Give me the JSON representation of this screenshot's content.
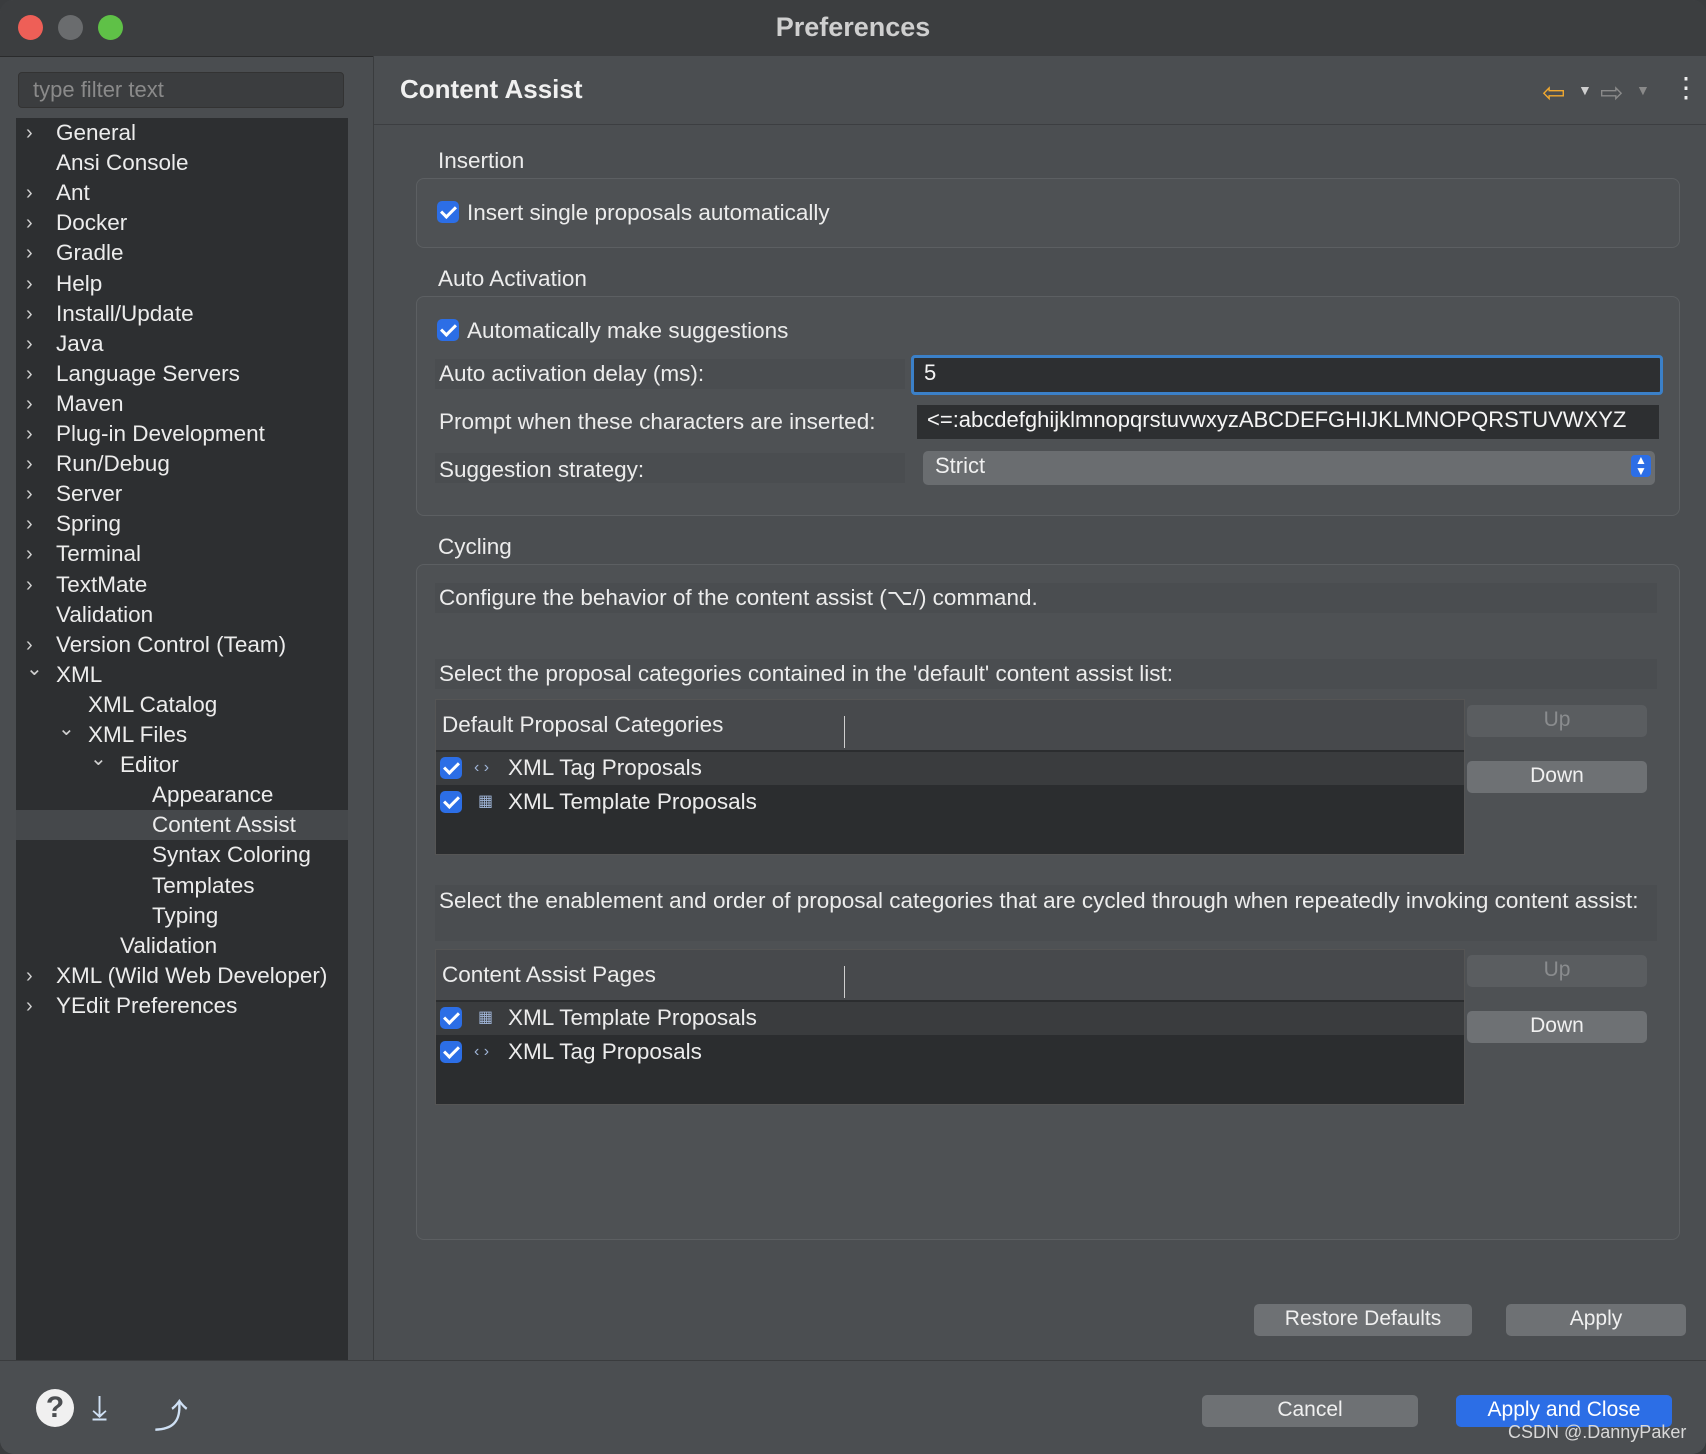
{
  "window": {
    "title": "Preferences"
  },
  "sidebar": {
    "filter_placeholder": "type filter text",
    "items": [
      {
        "label": "General",
        "expander": "collapsed",
        "depth": 0
      },
      {
        "label": "Ansi Console",
        "expander": "none",
        "depth": 0
      },
      {
        "label": "Ant",
        "expander": "collapsed",
        "depth": 0
      },
      {
        "label": "Docker",
        "expander": "collapsed",
        "depth": 0
      },
      {
        "label": "Gradle",
        "expander": "collapsed",
        "depth": 0
      },
      {
        "label": "Help",
        "expander": "collapsed",
        "depth": 0
      },
      {
        "label": "Install/Update",
        "expander": "collapsed",
        "depth": 0
      },
      {
        "label": "Java",
        "expander": "collapsed",
        "depth": 0
      },
      {
        "label": "Language Servers",
        "expander": "collapsed",
        "depth": 0
      },
      {
        "label": "Maven",
        "expander": "collapsed",
        "depth": 0
      },
      {
        "label": "Plug-in Development",
        "expander": "collapsed",
        "depth": 0
      },
      {
        "label": "Run/Debug",
        "expander": "collapsed",
        "depth": 0
      },
      {
        "label": "Server",
        "expander": "collapsed",
        "depth": 0
      },
      {
        "label": "Spring",
        "expander": "collapsed",
        "depth": 0
      },
      {
        "label": "Terminal",
        "expander": "collapsed",
        "depth": 0
      },
      {
        "label": "TextMate",
        "expander": "collapsed",
        "depth": 0
      },
      {
        "label": "Validation",
        "expander": "none",
        "depth": 0
      },
      {
        "label": "Version Control (Team)",
        "expander": "collapsed",
        "depth": 0
      },
      {
        "label": "XML",
        "expander": "expanded",
        "depth": 0
      },
      {
        "label": "XML Catalog",
        "expander": "none",
        "depth": 1
      },
      {
        "label": "XML Files",
        "expander": "expanded",
        "depth": 1
      },
      {
        "label": "Editor",
        "expander": "expanded",
        "depth": 2
      },
      {
        "label": "Appearance",
        "expander": "none",
        "depth": 3
      },
      {
        "label": "Content Assist",
        "expander": "none",
        "depth": 3,
        "selected": true
      },
      {
        "label": "Syntax Coloring",
        "expander": "none",
        "depth": 3
      },
      {
        "label": "Templates",
        "expander": "none",
        "depth": 3
      },
      {
        "label": "Typing",
        "expander": "none",
        "depth": 3
      },
      {
        "label": "Validation",
        "expander": "none",
        "depth": 2
      },
      {
        "label": "XML (Wild Web Developer)",
        "expander": "collapsed",
        "depth": 0
      },
      {
        "label": "YEdit Preferences",
        "expander": "collapsed",
        "depth": 0
      }
    ]
  },
  "page": {
    "title": "Content Assist",
    "insertion": {
      "label": "Insertion",
      "insert_single": "Insert single proposals automatically",
      "insert_single_checked": true
    },
    "auto_activation": {
      "label": "Auto Activation",
      "auto_suggest": "Automatically make suggestions",
      "auto_suggest_checked": true,
      "delay_label": "Auto activation delay (ms):",
      "delay_value": "5",
      "prompt_label": "Prompt when these characters are inserted:",
      "prompt_value": "<=:abcdefghijklmnopqrstuvwxyzABCDEFGHIJKLMNOPQRSTUVWXYZ",
      "strategy_label": "Suggestion strategy:",
      "strategy_value": "Strict"
    },
    "cycling": {
      "label": "Cycling",
      "description": "Configure the behavior of the content assist (⌥/) command.",
      "default_list_label": "Select the proposal categories contained in the 'default' content assist list:",
      "default_table": {
        "header": "Default Proposal Categories",
        "rows": [
          {
            "label": "XML Tag Proposals",
            "icon": "xml-tag-icon",
            "checked": true
          },
          {
            "label": "XML Template Proposals",
            "icon": "xml-template-icon",
            "checked": true
          }
        ]
      },
      "cycled_label": "Select the enablement and order of proposal categories that are cycled through when repeatedly invoking content assist:",
      "pages_table": {
        "header": "Content Assist Pages",
        "rows": [
          {
            "label": "XML Template Proposals",
            "icon": "xml-template-icon",
            "checked": true
          },
          {
            "label": "XML Tag Proposals",
            "icon": "xml-tag-icon",
            "checked": true
          }
        ]
      },
      "up_label": "Up",
      "down_label": "Down"
    },
    "restore_defaults": "Restore Defaults",
    "apply": "Apply"
  },
  "footer": {
    "cancel": "Cancel",
    "apply_close": "Apply and Close",
    "watermark": "CSDN @.DannyPaker"
  },
  "colors": {
    "accent": "#2c6ee6",
    "back_arrow": "#f0a830",
    "focus_ring": "#3b80c8"
  }
}
